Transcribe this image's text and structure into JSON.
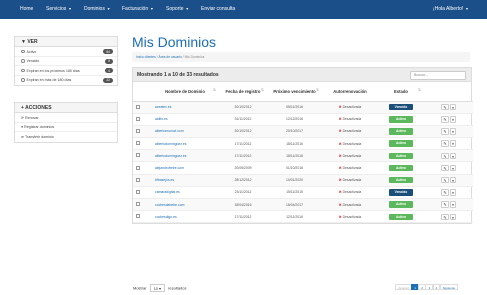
{
  "nav": {
    "home": "Home",
    "servicios": "Servicios",
    "dominios": "Dominios",
    "facturacion": "Facturación",
    "soporte": "Soporte",
    "enviar": "Enviar consulta",
    "greeting": "¡Hola Alberto!"
  },
  "filter": {
    "title": "VER",
    "items": [
      {
        "label": "Activo",
        "count": "84"
      },
      {
        "label": "Vencido",
        "count": "9"
      },
      {
        "label": "Expiran en los próximos 180 días",
        "count": "4"
      },
      {
        "label": "Expiran en más de 180 días",
        "count": "22"
      }
    ]
  },
  "actions": {
    "title": "ACCIONES",
    "items": [
      "Renovar",
      "Registrar dominios",
      "Transferir dominio"
    ]
  },
  "page": {
    "title": "Mis Dominios",
    "breadcrumb": [
      "Inicio clientes",
      "Área de usuario",
      "Mis Dominios"
    ]
  },
  "table": {
    "summary": "Mostrando 1 a 10 de 33 resultados",
    "search_placeholder": "Buscar...",
    "headers": [
      "Nombre de Dominio",
      "Fecha de registro",
      "Próximo vencimiento",
      "Autorrenovación",
      "Estado"
    ],
    "rows": [
      {
        "domain": "aceatex.es",
        "reg": "20/10/2012",
        "next": "05/11/2016",
        "auto": "Desactivada",
        "status": "Vencido"
      },
      {
        "domain": "aldifo.es",
        "reg": "31/11/2012",
        "next": "12/12/2016",
        "auto": "Desactivada",
        "status": "Activo"
      },
      {
        "domain": "albertomunozl.com",
        "reg": "20/10/2012",
        "next": "20/10/2017",
        "auto": "Desactivada",
        "status": "Activo"
      },
      {
        "domain": "albertodominguez.es",
        "reg": "17/11/2012",
        "next": "18/11/2016",
        "auto": "Desactivada",
        "status": "Activo"
      },
      {
        "domain": "albertodominguez.es",
        "reg": "17/11/2012",
        "next": "18/11/2016",
        "auto": "Desactivada",
        "status": "Activo"
      },
      {
        "domain": "alejandrofreire.com",
        "reg": "20/05/2009",
        "next": "01/10/2016",
        "auto": "Desactivada",
        "status": "Activo"
      },
      {
        "domain": "bfbasejos.es",
        "reg": "28/12/2012",
        "next": "10/01/2020",
        "auto": "Desactivada",
        "status": "Activo"
      },
      {
        "domain": "camaradigital.es",
        "reg": "23/11/2012",
        "next": "15/11/2015",
        "auto": "Desactivada",
        "status": "Vencido"
      },
      {
        "domain": "cochesdebebe.com",
        "reg": "18/04/2016",
        "next": "18/04/2017",
        "auto": "Desactivada",
        "status": "Activo"
      },
      {
        "domain": "cochesdigo.es",
        "reg": "17/11/2012",
        "next": "12/11/2016",
        "auto": "Desactivada",
        "status": "Activo"
      }
    ]
  },
  "footer": {
    "show_label": "Mostrar",
    "show_value": "10",
    "results_label": "resultados",
    "pages": [
      "Anterior",
      "1",
      "2",
      "3",
      "4",
      "Siguiente"
    ]
  },
  "colors": {
    "nav": "#1b4f8a",
    "activo": "#5cb85c",
    "vencido": "#1b4f7a",
    "link": "#1b6fb3"
  }
}
